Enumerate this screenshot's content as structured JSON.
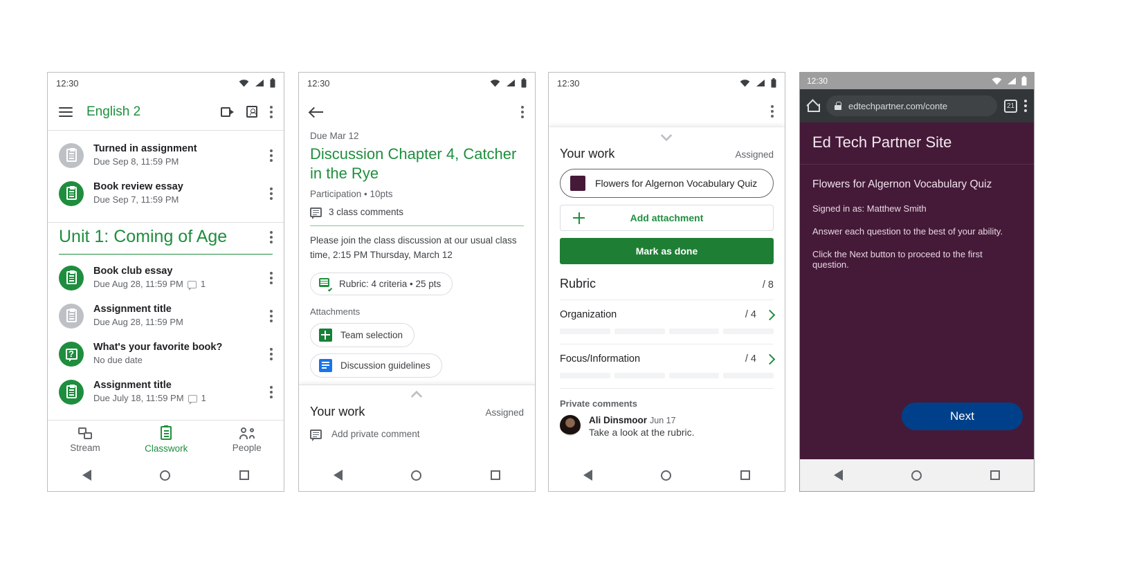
{
  "screens": {
    "classwork": {
      "status_time": "12:30",
      "appbar": {
        "title": "English 2"
      },
      "ungrouped_items": [
        {
          "title": "Turned in assignment",
          "subtitle": "Due Sep 8, 11:59 PM",
          "icon": "assignment-icon",
          "state": "gray"
        },
        {
          "title": "Book review essay",
          "subtitle": "Due Sep 7, 11:59 PM",
          "icon": "assignment-icon",
          "state": "green"
        }
      ],
      "topic": {
        "title": "Unit 1: Coming of Age"
      },
      "topic_items": [
        {
          "title": "Book club essay",
          "subtitle": "Due Aug 28, 11:59 PM",
          "comments": "1",
          "icon": "assignment-icon",
          "state": "green"
        },
        {
          "title": "Assignment title",
          "subtitle": "Due Aug 28, 11:59 PM",
          "comments": "",
          "icon": "assignment-icon",
          "state": "gray"
        },
        {
          "title": "What's your favorite book?",
          "subtitle": "No due date",
          "comments": "",
          "icon": "question-icon",
          "state": "green"
        },
        {
          "title": "Assignment title",
          "subtitle": "Due July 18, 11:59 PM",
          "comments": "1",
          "icon": "assignment-icon",
          "state": "green"
        }
      ],
      "bottom_nav": [
        {
          "label": "Stream",
          "icon": "stream-icon",
          "active": false
        },
        {
          "label": "Classwork",
          "icon": "classwork-icon",
          "active": true
        },
        {
          "label": "People",
          "icon": "people-icon",
          "active": false
        }
      ]
    },
    "assignment_detail": {
      "status_time": "12:30",
      "due": "Due Mar 12",
      "title": "Discussion Chapter 4, Catcher in the Rye",
      "meta": "Participation • 10pts",
      "class_comments": "3 class comments",
      "description": "Please join the class discussion at our usual class time, 2:15 PM Thursday, March 12",
      "rubric_chip": "Rubric: 4 criteria • 25 pts",
      "attachments_label": "Attachments",
      "attachments": [
        {
          "name": "Team selection",
          "icon": "sheets-icon"
        },
        {
          "name": "Discussion guidelines",
          "icon": "docs-icon"
        }
      ],
      "your_work": {
        "heading": "Your work",
        "status": "Assigned",
        "add_comment": "Add private comment"
      }
    },
    "your_work": {
      "status_time": "12:30",
      "heading": "Your work",
      "status": "Assigned",
      "attachment": "Flowers for Algernon Vocabulary Quiz",
      "add_attachment": "Add attachment",
      "mark_as_done": "Mark as done",
      "rubric": {
        "heading": "Rubric",
        "total": "/ 8",
        "criteria": [
          {
            "name": "Organization",
            "score": "/ 4"
          },
          {
            "name": "Focus/Information",
            "score": "/ 4"
          }
        ]
      },
      "private_comments": {
        "label": "Private comments",
        "items": [
          {
            "author": "Ali Dinsmoor",
            "date": "Jun 17",
            "text": "Take a look at the rubric."
          }
        ]
      }
    },
    "browser": {
      "status_time": "12:30",
      "url": "edtechpartner.com/conte",
      "tab_count": "21",
      "site_title": "Ed Tech Partner Site",
      "quiz_title": "Flowers for Algernon Vocabulary Quiz",
      "lines": [
        "Signed in as: Matthew Smith",
        "Answer each question to the best of your ability.",
        "Click the Next button to proceed to the first question."
      ],
      "next_label": "Next"
    }
  },
  "colors": {
    "green": "#1e8e3e",
    "green_dark": "#1e7e34",
    "purple": "#451a38",
    "blue": "#00408a"
  }
}
